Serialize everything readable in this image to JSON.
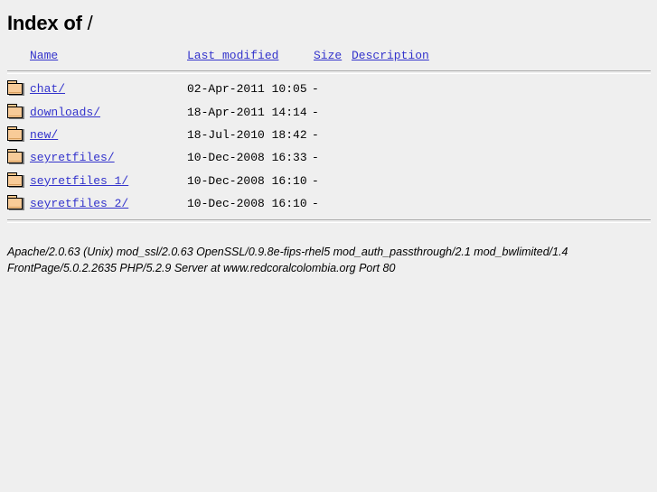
{
  "page": {
    "title_prefix": "Index of",
    "title_path": "/"
  },
  "table": {
    "headers": {
      "name": "Name",
      "last_modified": "Last modified",
      "size": "Size",
      "description": "Description"
    },
    "rows": [
      {
        "icon": "folder-icon",
        "name": "chat/",
        "last_modified": "02-Apr-2011 10:05",
        "size": "-",
        "description": ""
      },
      {
        "icon": "folder-icon",
        "name": "downloads/",
        "last_modified": "18-Apr-2011 14:14",
        "size": "-",
        "description": ""
      },
      {
        "icon": "folder-icon",
        "name": "new/",
        "last_modified": "18-Jul-2010 18:42",
        "size": "-",
        "description": ""
      },
      {
        "icon": "folder-icon",
        "name": "seyretfiles/",
        "last_modified": "10-Dec-2008 16:33",
        "size": "-",
        "description": ""
      },
      {
        "icon": "folder-icon",
        "name": "seyretfiles 1/",
        "last_modified": "10-Dec-2008 16:10",
        "size": "-",
        "description": ""
      },
      {
        "icon": "folder-icon",
        "name": "seyretfiles 2/",
        "last_modified": "10-Dec-2008 16:10",
        "size": "-",
        "description": ""
      }
    ]
  },
  "footer": {
    "line1": "Apache/2.0.63 (Unix) mod_ssl/2.0.63 OpenSSL/0.9.8e-fips-rhel5 mod_auth_passthrough/2.1 mod_bwlimited/1.4",
    "line2": "FrontPage/5.0.2.2635 PHP/5.2.9 Server at www.redcoralcolombia.org Port 80"
  },
  "colors": {
    "background": "#efefef",
    "link": "#3333cc",
    "rule": "#aaaaaa",
    "folder_body": "#f8cb98"
  }
}
